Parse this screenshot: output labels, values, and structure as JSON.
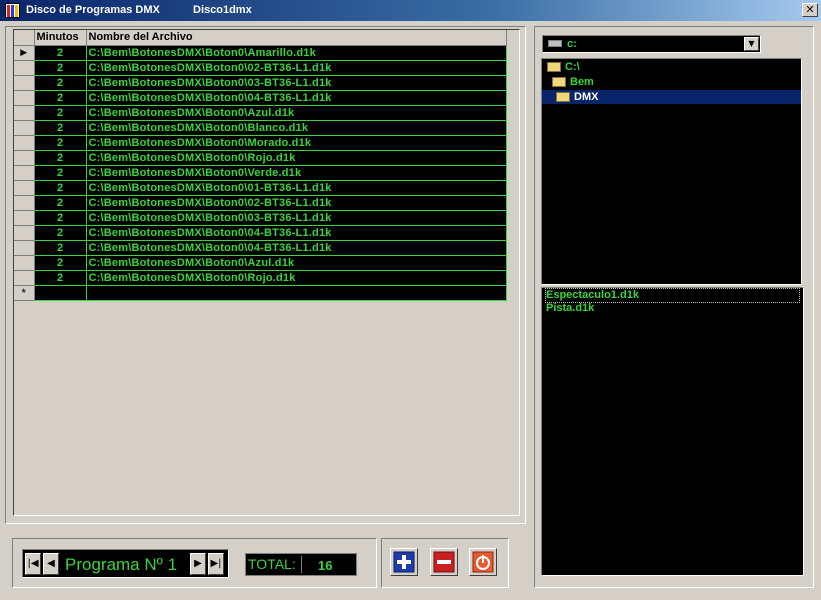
{
  "window": {
    "title": "Disco de Programas DMX",
    "document": "Disco1dmx",
    "close_label": "✕"
  },
  "grid": {
    "columns": [
      "Minutos",
      "Nombre del Archivo"
    ],
    "rows": [
      {
        "minutes": "2",
        "file": "C:\\Bem\\BotonesDMX\\Boton0\\Amarillo.d1k"
      },
      {
        "minutes": "2",
        "file": "C:\\Bem\\BotonesDMX\\Boton0\\02-BT36-L1.d1k"
      },
      {
        "minutes": "2",
        "file": "C:\\Bem\\BotonesDMX\\Boton0\\03-BT36-L1.d1k"
      },
      {
        "minutes": "2",
        "file": "C:\\Bem\\BotonesDMX\\Boton0\\04-BT36-L1.d1k"
      },
      {
        "minutes": "2",
        "file": "C:\\Bem\\BotonesDMX\\Boton0\\Azul.d1k"
      },
      {
        "minutes": "2",
        "file": "C:\\Bem\\BotonesDMX\\Boton0\\Blanco.d1k"
      },
      {
        "minutes": "2",
        "file": "C:\\Bem\\BotonesDMX\\Boton0\\Morado.d1k"
      },
      {
        "minutes": "2",
        "file": "C:\\Bem\\BotonesDMX\\Boton0\\Rojo.d1k"
      },
      {
        "minutes": "2",
        "file": "C:\\Bem\\BotonesDMX\\Boton0\\Verde.d1k"
      },
      {
        "minutes": "2",
        "file": "C:\\Bem\\BotonesDMX\\Boton0\\01-BT36-L1.d1k"
      },
      {
        "minutes": "2",
        "file": "C:\\Bem\\BotonesDMX\\Boton0\\02-BT36-L1.d1k"
      },
      {
        "minutes": "2",
        "file": "C:\\Bem\\BotonesDMX\\Boton0\\03-BT36-L1.d1k"
      },
      {
        "minutes": "2",
        "file": "C:\\Bem\\BotonesDMX\\Boton0\\04-BT36-L1.d1k"
      },
      {
        "minutes": "2",
        "file": "C:\\Bem\\BotonesDMX\\Boton0\\04-BT36-L1.d1k"
      },
      {
        "minutes": "2",
        "file": "C:\\Bem\\BotonesDMX\\Boton0\\Azul.d1k"
      },
      {
        "minutes": "2",
        "file": "C:\\Bem\\BotonesDMX\\Boton0\\Rojo.d1k"
      }
    ],
    "new_row_marker": "*",
    "current_row_marker": "▶"
  },
  "navigator": {
    "first": "|◀",
    "prev": "◀",
    "label": "Programa Nº 1",
    "next": "▶",
    "last": "▶|"
  },
  "total": {
    "label": "TOTAL:",
    "value": "16"
  },
  "actions": {
    "add_icon": "plus-icon",
    "remove_icon": "minus-icon",
    "power_icon": "power-icon"
  },
  "drive": {
    "label": "c:"
  },
  "directories": [
    "C:\\",
    "Bem",
    "DMX"
  ],
  "selected_directory": "DMX",
  "files": [
    "Espectaculo1.d1k",
    "Pista.d1k"
  ],
  "colors": {
    "text_green": "#3cd43c",
    "selection": "#0a246a"
  }
}
